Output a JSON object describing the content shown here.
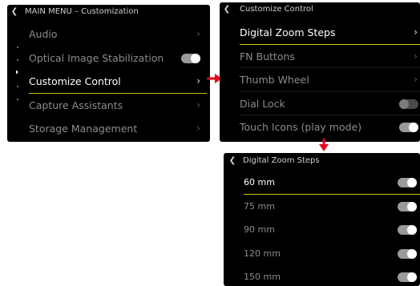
{
  "screen1": {
    "back_icon": "chevron-left-icon",
    "title": "MAIN MENU – Customization",
    "items": [
      {
        "label": "Audio",
        "control": "chevron"
      },
      {
        "label": "Optical Image Stabilization",
        "control": "toggle-on"
      },
      {
        "label": "Customize Control",
        "control": "chevron",
        "selected": true
      },
      {
        "label": "Capture Assistants",
        "control": "chevron"
      },
      {
        "label": "Storage Management",
        "control": "chevron"
      }
    ]
  },
  "screen2": {
    "back_icon": "chevron-left-icon",
    "title": "Customize Control",
    "items": [
      {
        "label": "Digital Zoom Steps",
        "control": "chevron",
        "selected": true
      },
      {
        "label": "FN Buttons",
        "control": "chevron"
      },
      {
        "label": "Thumb Wheel",
        "control": "chevron"
      },
      {
        "label": "Dial Lock",
        "control": "toggle-off"
      },
      {
        "label": "Touch Icons (play mode)",
        "control": "toggle-on"
      }
    ]
  },
  "screen3": {
    "back_icon": "chevron-left-icon",
    "title": "Digital Zoom Steps",
    "items": [
      {
        "label": "60 mm",
        "control": "toggle-on",
        "selected": true
      },
      {
        "label": "75 mm",
        "control": "toggle-on"
      },
      {
        "label": "90 mm",
        "control": "toggle-on"
      },
      {
        "label": "120 mm",
        "control": "toggle-on"
      },
      {
        "label": "150 mm",
        "control": "toggle-on"
      }
    ]
  },
  "icons": {
    "chevron": "chevron-right-icon",
    "toggle": "toggle-switch-icon",
    "arrow_right": "arrow-right-icon",
    "arrow_down": "arrow-down-icon"
  },
  "colors": {
    "screen_bg": "#000000",
    "selection_underline": "#c9c800",
    "arrow": "#e8001c",
    "text_selected": "#ffffff",
    "text_normal": "#8c8c8c"
  }
}
